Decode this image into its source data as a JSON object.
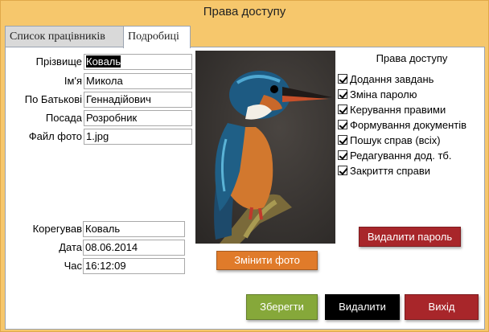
{
  "window": {
    "title": "Права доступу"
  },
  "tabs": [
    {
      "label": "Список працівників",
      "active": false
    },
    {
      "label": "Подробиці",
      "active": true
    }
  ],
  "form": {
    "surname": {
      "label": "Прізвище",
      "value": "Коваль"
    },
    "name": {
      "label": "Ім'я",
      "value": "Микола"
    },
    "patronymic": {
      "label": "По Батькові",
      "value": "Геннадійович"
    },
    "position": {
      "label": "Посада",
      "value": "Розробник"
    },
    "photo_file": {
      "label": "Файл фото",
      "value": "1.jpg"
    },
    "edited_by": {
      "label": "Корегував",
      "value": "Коваль"
    },
    "date": {
      "label": "Дата",
      "value": "08.06.2014"
    },
    "time": {
      "label": "Час",
      "value": "16:12:09"
    }
  },
  "rights": {
    "title": "Права доступу",
    "items": [
      {
        "label": "Додання завдань",
        "checked": true
      },
      {
        "label": "Зміна паролю",
        "checked": true
      },
      {
        "label": "Керування правими",
        "checked": true
      },
      {
        "label": "Формування документів",
        "checked": true
      },
      {
        "label": "Пошук справ (всіх)",
        "checked": true
      },
      {
        "label": "Редагування дод. тб.",
        "checked": true
      },
      {
        "label": "Закриття справи",
        "checked": true
      }
    ]
  },
  "buttons": {
    "change_photo": "Змінити фото",
    "delete_password": "Видалити пароль",
    "save": "Зберегти",
    "delete": "Видалити",
    "exit": "Вихід"
  },
  "colors": {
    "window_bg": "#f6c76c",
    "change_photo_btn": "#e07b2a",
    "delete_password_btn": "#a8262a",
    "save_btn": "#86a83a",
    "delete_btn": "#000000",
    "exit_btn": "#a8262a"
  },
  "photo": {
    "icon": "kingfisher-photo"
  }
}
